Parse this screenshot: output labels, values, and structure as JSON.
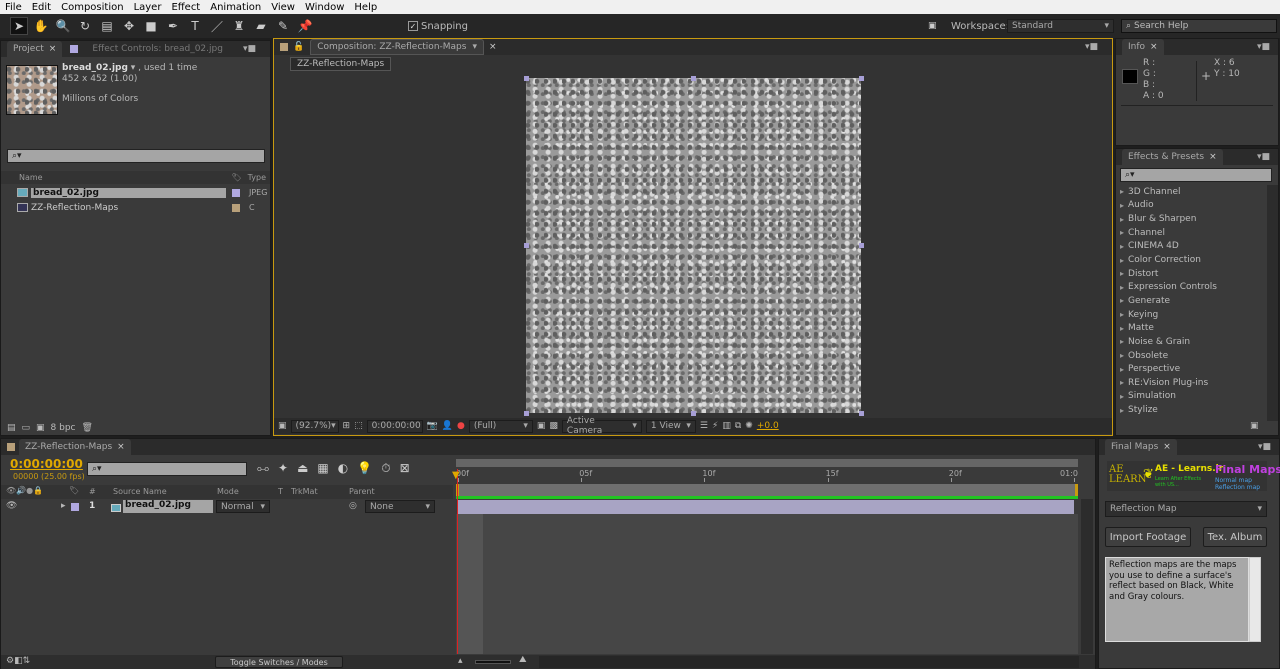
{
  "menu": [
    "File",
    "Edit",
    "Composition",
    "Layer",
    "Effect",
    "Animation",
    "View",
    "Window",
    "Help"
  ],
  "toolbar": {
    "tools": [
      "selection-tool",
      "hand-tool",
      "zoom-tool",
      "rotation-tool",
      "camera-tool",
      "pan-behind-tool",
      "rectangle-tool",
      "pen-tool",
      "type-tool",
      "brush-tool",
      "clone-stamp-tool",
      "eraser-tool",
      "roto-brush-tool",
      "puppet-pin-tool"
    ],
    "snapping_label": "Snapping",
    "snapping_checked": true,
    "workspace_label": "Workspace:",
    "workspace_value": "Standard",
    "search_placeholder": "Search Help"
  },
  "project": {
    "tab": "Project",
    "effect_controls_tab": "Effect Controls: bread_02.jpg",
    "item_name": "bread_02.jpg",
    "used": ", used 1 time",
    "dimensions": "452 x 452 (1.00)",
    "colors": "Millions of Colors",
    "col_name": "Name",
    "col_type": "Type",
    "items": [
      {
        "name": "bread_02.jpg",
        "type": "JPEG",
        "label_color": "#b0a8e0"
      },
      {
        "name": "ZZ-Reflection-Maps",
        "type": "C",
        "label_color": "#b8a07a"
      }
    ],
    "bpc": "8 bpc"
  },
  "composition": {
    "tab": "Composition: ZZ-Reflection-Maps",
    "sub_tab": "ZZ-Reflection-Maps",
    "zoom": "(92.7%)",
    "timecode": "0:00:00:00",
    "resolution": "(Full)",
    "camera": "Active Camera",
    "views": "1 View",
    "exposure": "+0.0"
  },
  "info": {
    "tab": "Info",
    "r": "R :",
    "g": "G :",
    "b": "B :",
    "a": "A : 0",
    "x": "X : 6",
    "y": "Y : 10"
  },
  "effects": {
    "tab": "Effects & Presets",
    "items": [
      "3D Channel",
      "Audio",
      "Blur & Sharpen",
      "Channel",
      "CINEMA 4D",
      "Color Correction",
      "Distort",
      "Expression Controls",
      "Generate",
      "Keying",
      "Matte",
      "Noise & Grain",
      "Obsolete",
      "Perspective",
      "RE:Vision Plug-ins",
      "Simulation",
      "Stylize"
    ]
  },
  "timeline": {
    "tab": "ZZ-Reflection-Maps",
    "timecode": "0:00:00:00",
    "fps": "00000 (25.00 fps)",
    "cols": {
      "num": "#",
      "source": "Source Name",
      "mode": "Mode",
      "t": "T",
      "trkmat": "TrkMat",
      "parent": "Parent"
    },
    "layer": {
      "num": "1",
      "name": "bread_02.jpg",
      "mode": "Normal",
      "parent": "None"
    },
    "ruler": [
      "00f",
      "05f",
      "10f",
      "15f",
      "20f",
      "01:0"
    ],
    "toggle": "Toggle Switches / Modes"
  },
  "final_maps": {
    "tab": "Final Maps",
    "logo": "AE LEARN",
    "brand": "AE - Learns.ir",
    "brand_sub": "Learn After Effects with US...",
    "title": "Final Maps",
    "line1": "Normal map",
    "line2": "Reflection map",
    "dropdown": "Reflection Map",
    "import_btn": "Import Footage",
    "album_btn": "Tex. Album",
    "description": "Reflection maps are the maps you use to define a surface's reflect based on Black, White and Gray colours."
  },
  "colors": {
    "accent": "#e0a800",
    "layer_bar": "#a8a4c4",
    "work_area": "#22c422",
    "playhead": "#e02020"
  }
}
